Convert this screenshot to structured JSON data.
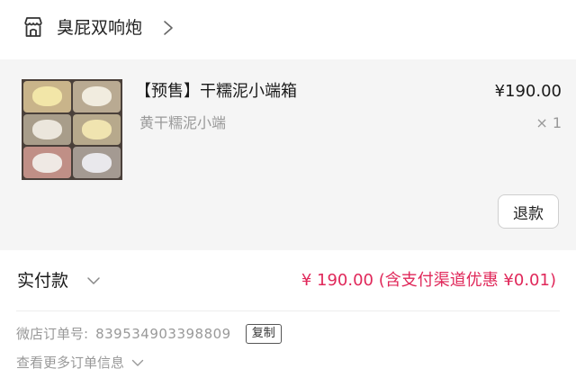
{
  "shop": {
    "name": "臭屁双响炮",
    "icon": "storefront-icon",
    "chevron_icon": "chevron-right-icon"
  },
  "item": {
    "title": "【预售】干糯泥小端箱",
    "price": "¥190.00",
    "spec": "黄干糯泥小端",
    "quantity": "× 1",
    "refund_label": "退款"
  },
  "payment": {
    "label": "实付款",
    "chevron_icon": "chevron-down-icon",
    "amount": "¥ 190.00 (含支付渠道优惠 ¥0.01)",
    "amount_color": "#e0285a"
  },
  "order": {
    "number_label": "微店订单号:",
    "number_value": "839534903398809",
    "copy_label": "复制",
    "more_info_label": "查看更多订单信息",
    "more_info_icon": "chevron-down-icon"
  }
}
